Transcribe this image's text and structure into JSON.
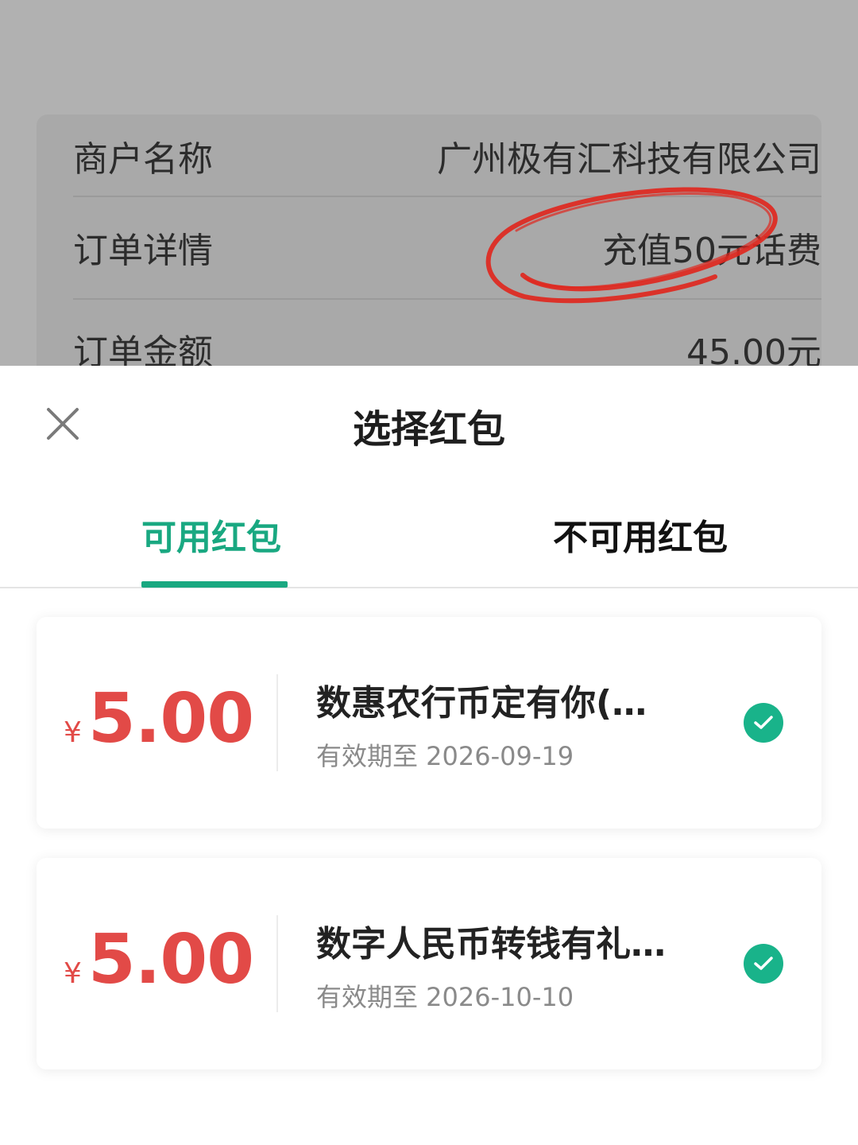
{
  "order": {
    "rows": [
      {
        "label": "商户名称",
        "value": "广州极有汇科技有限公司"
      },
      {
        "label": "订单详情",
        "value": "充值50元话费"
      },
      {
        "label": "订单金额",
        "value": "45.00元"
      }
    ]
  },
  "sheet": {
    "title": "选择红包",
    "close_icon": "close-icon",
    "tabs": [
      {
        "label": "可用红包",
        "active": true
      },
      {
        "label": "不可用红包",
        "active": false
      }
    ],
    "accent_color": "#19a881",
    "amount_color": "#e24a47",
    "coupons": [
      {
        "currency": "¥",
        "amount": "5.00",
        "name": "数惠农行币定有你(…",
        "expiry": "有效期至 2026-09-19",
        "selected": true
      },
      {
        "currency": "¥",
        "amount": "5.00",
        "name": "数字人民币转钱有礼…",
        "expiry": "有效期至 2026-10-10",
        "selected": true
      }
    ]
  }
}
